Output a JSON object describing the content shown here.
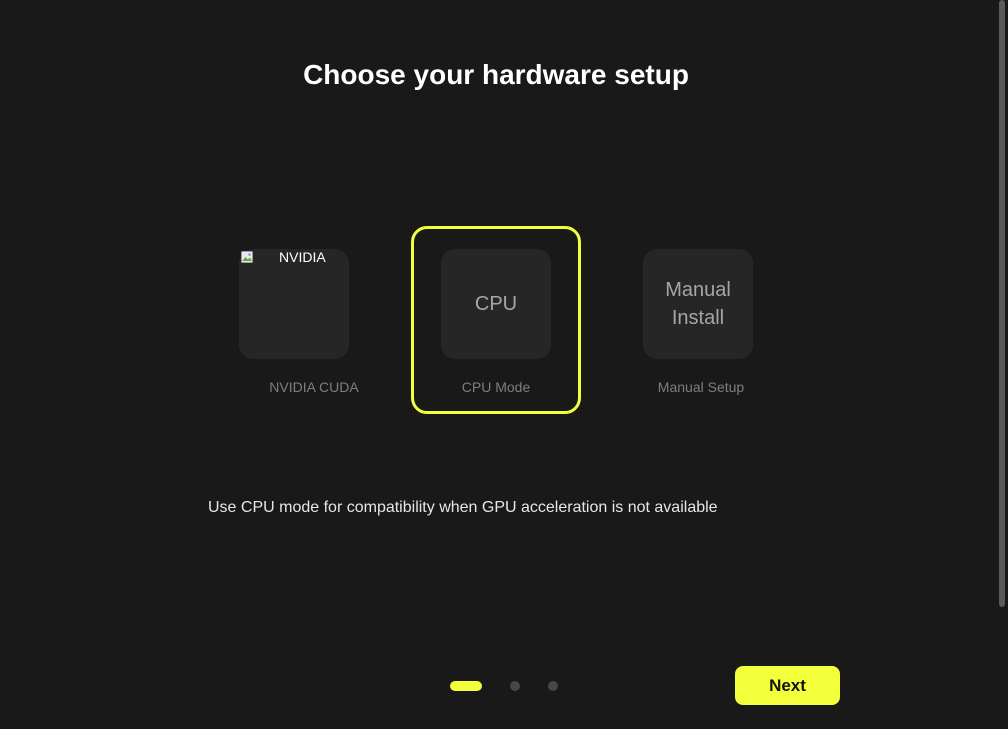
{
  "page": {
    "title": "Choose your hardware setup",
    "description": "Use CPU mode for compatibility when GPU acceleration is not available"
  },
  "options": [
    {
      "id": "nvidia",
      "tile_alt_text": "NVIDIA",
      "caption": "NVIDIA CUDA",
      "selected": false,
      "tile_icon": "broken-image-icon"
    },
    {
      "id": "cpu",
      "tile_text": "CPU",
      "caption": "CPU Mode",
      "selected": true
    },
    {
      "id": "manual",
      "tile_text_line1": "Manual",
      "tile_text_line2": "Install",
      "caption": "Manual Setup",
      "selected": false
    }
  ],
  "pagination": {
    "total_steps": 3,
    "current_step": 1
  },
  "footer": {
    "next_label": "Next"
  },
  "colors": {
    "accent": "#f2ff3a",
    "background": "#191919",
    "tile": "#262626"
  }
}
